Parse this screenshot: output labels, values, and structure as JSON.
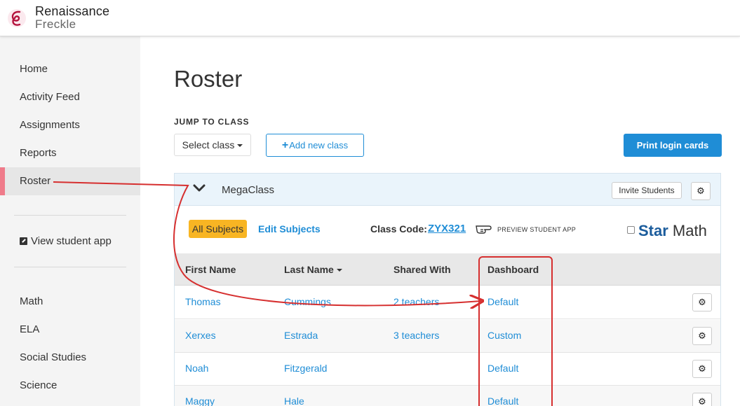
{
  "header": {
    "brand_line1": "Renaissance",
    "brand_line2": "Freckle"
  },
  "sidebar": {
    "items": [
      {
        "label": "Home"
      },
      {
        "label": "Activity Feed"
      },
      {
        "label": "Assignments"
      },
      {
        "label": "Reports"
      },
      {
        "label": "Roster",
        "active": true
      }
    ],
    "student_app": "View student app",
    "subjects": [
      {
        "label": "Math"
      },
      {
        "label": "ELA"
      },
      {
        "label": "Social Studies"
      },
      {
        "label": "Science"
      }
    ]
  },
  "main": {
    "title": "Roster",
    "jump_label": "JUMP TO CLASS",
    "select_class": "Select class",
    "add_class": "Add new class",
    "print_cards": "Print login cards"
  },
  "class_panel": {
    "name": "MegaClass",
    "invite": "Invite Students",
    "all_subjects": "All Subjects",
    "edit_subjects": "Edit Subjects",
    "class_code_label": "Class Code:",
    "class_code": "ZYX321",
    "preview": "PREVIEW STUDENT APP",
    "star_bold": "Star",
    "star_rest": " Math",
    "columns": [
      "First Name",
      "Last Name",
      "Shared With",
      "Dashboard"
    ],
    "rows": [
      {
        "first": "Thomas",
        "last": "Cummings",
        "shared": "2 teachers",
        "dashboard": "Default"
      },
      {
        "first": "Xerxes",
        "last": "Estrada",
        "shared": "3 teachers",
        "dashboard": "Custom"
      },
      {
        "first": "Noah",
        "last": "Fitzgerald",
        "shared": "",
        "dashboard": "Default"
      },
      {
        "first": "Maggy",
        "last": "Hale",
        "shared": "",
        "dashboard": "Default"
      }
    ]
  },
  "colors": {
    "accent": "#1f8dd6",
    "active_bar": "#ef7b8a",
    "subjects_chip": "#f8b523",
    "annotation": "#d62f2f"
  },
  "icons": [
    "freckle-logo-icon",
    "external-link-icon",
    "chevron-down-icon",
    "gear-icon",
    "pointing-hand-icon",
    "plus-icon",
    "caret-down-icon"
  ]
}
